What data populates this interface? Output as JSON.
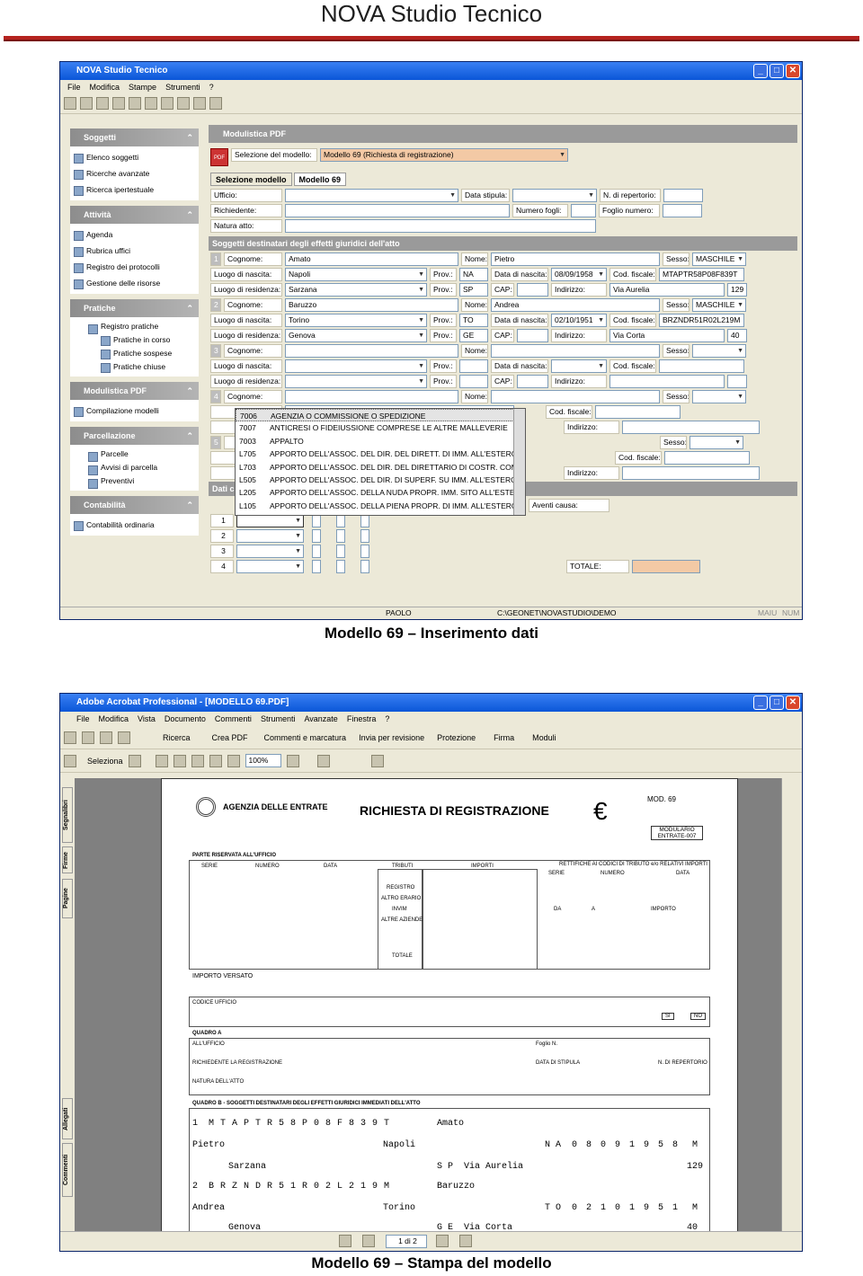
{
  "header": {
    "title": "NOVA Studio Tecnico"
  },
  "captions": {
    "top": "Modello 69 – Inserimento dati",
    "bottom": "Modello 69 – Stampa del modello"
  },
  "app1": {
    "title": "NOVA Studio Tecnico",
    "menu": [
      "File",
      "Modifica",
      "Stampe",
      "Strumenti",
      "?"
    ],
    "side": [
      {
        "h": "Soggetti",
        "items": [
          "Elenco soggetti",
          "Ricerche avanzate",
          "Ricerca ipertestuale"
        ]
      },
      {
        "h": "Attività",
        "items": [
          "Agenda",
          "Rubrica uffici",
          "Registro dei protocolli",
          "Gestione delle risorse"
        ]
      },
      {
        "h": "Pratiche",
        "items": [
          "Registro pratiche",
          "Pratiche in corso",
          "Pratiche sospese",
          "Pratiche chiuse"
        ]
      },
      {
        "h": "Modulistica PDF",
        "items": [
          "Compilazione modelli"
        ]
      },
      {
        "h": "Parcellazione",
        "items": [
          "Parcelle",
          "Avvisi di parcella",
          "Preventivi"
        ]
      },
      {
        "h": "Contabilità",
        "items": [
          "Contabilità ordinaria"
        ]
      }
    ],
    "main": {
      "header": "Modulistica PDF",
      "sel_label": "Selezione del modello:",
      "sel_value": "Modello 69 (Richiesta di registrazione)",
      "tabs": [
        "Selezione modello",
        "Modello 69"
      ],
      "ufficio": "Ufficio:",
      "data_stipula": "Data stipula:",
      "n_repertorio": "N. di repertorio:",
      "richiedente": "Richiedente:",
      "numero_fogli": "Numero fogli:",
      "foglio_numero": "Foglio numero:",
      "natura": "Natura atto:",
      "section": "Soggetti destinatari degli effetti giuridici dell'atto",
      "l_cognome": "Cognome:",
      "l_nome": "Nome:",
      "l_sesso": "Sesso:",
      "l_nascita": "Luogo di nascita:",
      "l_prov": "Prov.:",
      "l_data_nascita": "Data di nascita:",
      "l_cf": "Cod. fiscale:",
      "l_residenza": "Luogo di residenza:",
      "l_cap": "CAP:",
      "l_indirizzo": "Indirizzo:",
      "p1": {
        "n": "1",
        "cognome": "Amato",
        "nome": "Pietro",
        "sesso": "MASCHILE",
        "nascita": "Napoli",
        "prov": "NA",
        "data": "08/09/1958",
        "cf": "MTAPTR58P08F839T",
        "res": "Sarzana",
        "prov_r": "SP",
        "indirizzo": "Via Aurelia",
        "civico": "129"
      },
      "p2": {
        "n": "2",
        "cognome": "Baruzzo",
        "nome": "Andrea",
        "sesso": "MASCHILE",
        "nascita": "Torino",
        "prov": "TO",
        "data": "02/10/1951",
        "cf": "BRZNDR51R02L219M",
        "res": "Genova",
        "prov_r": "GE",
        "indirizzo": "Via Corta",
        "civico": "40"
      },
      "p3": {
        "n": "3"
      },
      "p4": {
        "n": "4"
      },
      "p5": {
        "n": "5"
      },
      "dati": "Dati c",
      "aventi": "Aventi causa:",
      "totale": "TOTALE:",
      "grid_rows": [
        "1",
        "2",
        "3",
        "4"
      ],
      "list": [
        [
          "7006",
          "AGENZIA O COMMISSIONE O SPEDIZIONE"
        ],
        [
          "7007",
          "ANTICRESI O FIDEIUSSIONE COMPRESE LE ALTRE MALLEVERIE"
        ],
        [
          "7003",
          "APPALTO"
        ],
        [
          "L705",
          "APPORTO DELL'ASSOC. DEL DIR. DEL DIRETT. DI IMM. ALL'ESTERO"
        ],
        [
          "L703",
          "APPORTO DELL'ASSOC. DEL DIR. DEL DIRETTARIO DI COSTR. COMM."
        ],
        [
          "L505",
          "APPORTO DELL'ASSOC. DEL DIR. DI SUPERF. SU IMM. ALL'ESTERO"
        ],
        [
          "L205",
          "APPORTO DELL'ASSOC. DELLA NUDA PROPR. IMM. SITO ALL'ESTERO"
        ],
        [
          "L105",
          "APPORTO DELL'ASSOC. DELLA PIENA PROPR. DI IMM. ALL'ESTERO"
        ]
      ]
    },
    "status": {
      "user": "PAOLO",
      "path": "C:\\GEONET\\NOVASTUDIO\\DEMO",
      "caps": "MAIU",
      "num": "NUM"
    }
  },
  "app2": {
    "title": "Adobe Acrobat Professional - [MODELLO 69.PDF]",
    "menu": [
      "File",
      "Modifica",
      "Vista",
      "Documento",
      "Commenti",
      "Strumenti",
      "Avanzate",
      "Finestra",
      "?"
    ],
    "tb1": [
      "Ricerca",
      "Crea PDF",
      "Commenti e marcatura",
      "Invia per revisione",
      "Protezione",
      "Firma",
      "Moduli"
    ],
    "tb2": {
      "select": "Seleziona",
      "zoom": "100%"
    },
    "side_tabs": [
      "Segnalibri",
      "Firme",
      "Pagine",
      "Allegati",
      "Commenti"
    ],
    "pager": "1 di 2",
    "doc": {
      "agency": "AGENZIA DELLE ENTRATE",
      "title": "RICHIESTA DI REGISTRAZIONE",
      "mod": "MOD. 69",
      "modulario": "MODULARIO ENTRATE-007",
      "parte": "PARTE RISERVATA ALL'UFFICIO",
      "cols": [
        "SERIE",
        "NUMERO",
        "DATA",
        "TRIBUTI",
        "IMPORTI"
      ],
      "rett": "RETTIFICHE AI CODICI DI TRIBUTO e/o RELATIVI IMPORTI",
      "reg": [
        "REGISTRO",
        "ALTRO ERARIO",
        "INVIM",
        "ALTRE AZIENDE",
        "TOTALE"
      ],
      "rcols": [
        "SERIE",
        "NUMERO",
        "DATA"
      ],
      "rcols2": [
        "DA",
        "A",
        "IMPORTO"
      ],
      "importo": "IMPORTO VERSATO",
      "codice": "CODICE UFFICIO",
      "si": "SI",
      "no": "NO",
      "quadro_a": "QUADRO A",
      "ufficio": "ALL'UFFICIO",
      "foglio": "Foglio N.",
      "richiedente": "RICHIEDENTE LA REGISTRAZIONE",
      "data_stipula": "DATA DI STIPULA",
      "repertorio": "N. DI REPERTORIO",
      "natura": "NATURA DELL'ATTO",
      "quadro_b": "QUADRO B - SOGGETTI DESTINATARI DEGLI EFFETTI GIURIDICI IMMEDIATI DELL'ATTO",
      "s1": {
        "n": "1",
        "cf": "MTAPTR58P08F839T",
        "cognome": "Amato",
        "nome": "Pietro",
        "comune": "Napoli",
        "prov": "N A",
        "data": "0 8 0 9 1 9 5 8",
        "sesso": "M",
        "dom": "Sarzana",
        "dprov": "S P",
        "via": "Via Aurelia",
        "civ": "129"
      },
      "s2": {
        "n": "2",
        "cf": "BRZNDR51R02L219M",
        "cognome": "Baruzzo",
        "nome": "Andrea",
        "comune": "Torino",
        "prov": "T O",
        "data": "0 2 1 0 1 9 5 1",
        "sesso": "M",
        "dom": "Genova",
        "dprov": "G E",
        "via": "Via Corta",
        "civ": "40"
      }
    }
  }
}
